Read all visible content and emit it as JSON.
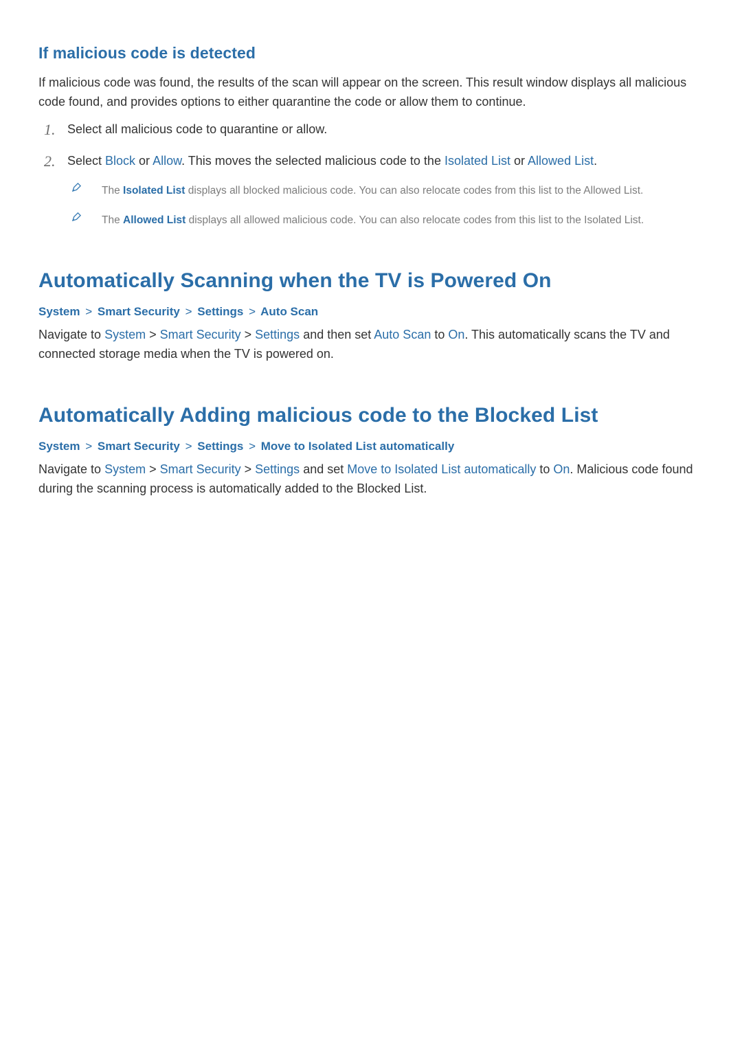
{
  "section1": {
    "title": "If malicious code is detected",
    "intro": "If malicious code was found, the results of the scan will appear on the screen. This result window displays all malicious code found, and provides options to either quarantine the code or allow them to continue.",
    "step1": "Select all malicious code to quarantine or allow.",
    "step2_a": "Select ",
    "step2_block": "Block",
    "step2_b": " or ",
    "step2_allow": "Allow",
    "step2_c": ". This moves the selected malicious code to the ",
    "step2_iso": "Isolated List",
    "step2_d": " or ",
    "step2_allowed": "Allowed List",
    "step2_e": ".",
    "note1_a": "The ",
    "note1_iso": "Isolated List",
    "note1_b": " displays all blocked malicious code. You can also relocate codes from this list to the Allowed List.",
    "note2_a": "The ",
    "note2_allowed": "Allowed List",
    "note2_b": " displays all allowed malicious code. You can also relocate codes from this list to the Isolated List."
  },
  "section2": {
    "title": "Automatically Scanning when the TV is Powered On",
    "crumbs": [
      "System",
      "Smart Security",
      "Settings",
      "Auto Scan"
    ],
    "p_a": "Navigate to ",
    "p_sys": "System",
    "p_b": " > ",
    "p_ss": "Smart Security",
    "p_c": " > ",
    "p_set": "Settings",
    "p_d": " and then set ",
    "p_auto": "Auto Scan",
    "p_e": " to ",
    "p_on": "On",
    "p_f": ". This automatically scans the TV and connected storage media when the TV is powered on."
  },
  "section3": {
    "title": "Automatically Adding malicious code to the Blocked List",
    "crumbs": [
      "System",
      "Smart Security",
      "Settings",
      "Move to Isolated List automatically"
    ],
    "p_a": "Navigate to ",
    "p_sys": "System",
    "p_b": " > ",
    "p_ss": "Smart Security",
    "p_c": " > ",
    "p_set": "Settings",
    "p_d": " and set ",
    "p_move": "Move to Isolated List automatically",
    "p_e": " to ",
    "p_on": "On",
    "p_f": ". Malicious code found during the scanning process is automatically added to the Blocked List."
  },
  "sep": ">"
}
